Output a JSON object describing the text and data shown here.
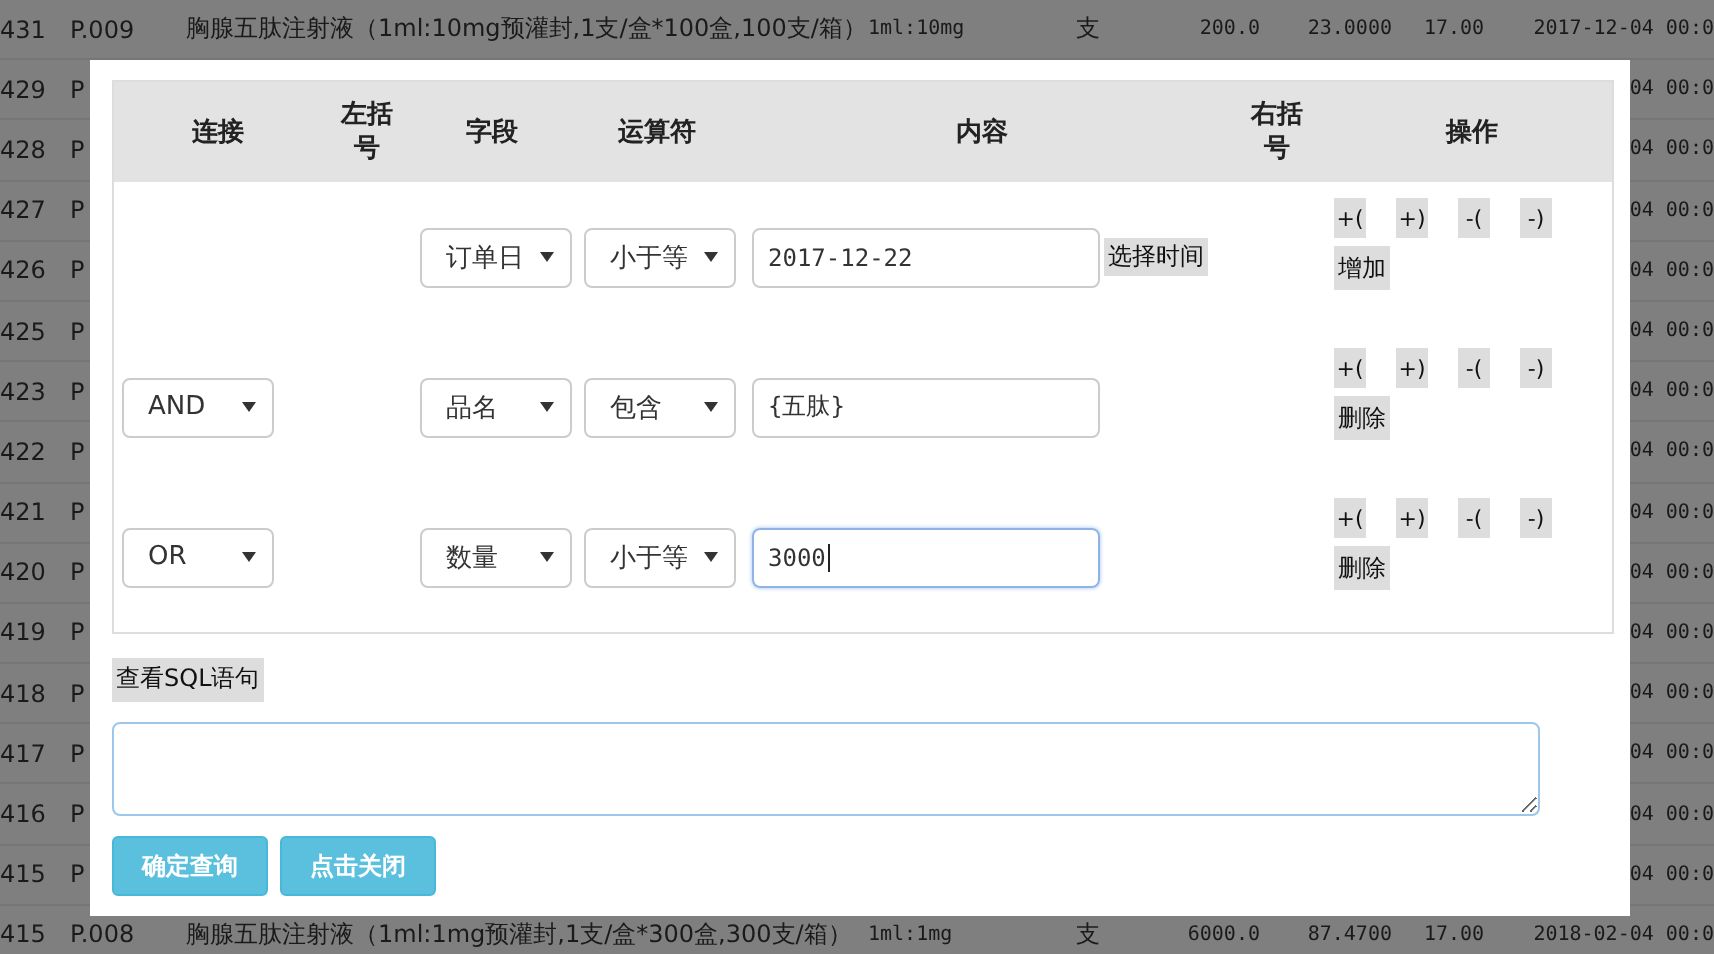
{
  "background_table": {
    "rows": [
      {
        "id": "431",
        "code": "P.009",
        "name": "胸腺五肽注射液（1ml:10mg预灌封,1支/盒*100盒,100支/箱）",
        "spec": "1ml:10mg",
        "unit": "支",
        "quantity": "200.0",
        "price": "23.0000",
        "rate": "17.00",
        "date": "2017-12-04 00:0"
      },
      {
        "id": "429",
        "code": "P",
        "date": "04 00:0"
      },
      {
        "id": "428",
        "code": "P",
        "date": "04 00:0"
      },
      {
        "id": "427",
        "code": "P",
        "date": "04 00:0"
      },
      {
        "id": "426",
        "code": "P",
        "date": "04 00:0"
      },
      {
        "id": "425",
        "code": "P",
        "date": "04 00:0"
      },
      {
        "id": "423",
        "code": "P",
        "date": "04 00:0"
      },
      {
        "id": "422",
        "code": "P",
        "date": "04 00:0"
      },
      {
        "id": "421",
        "code": "P",
        "date": "04 00:0"
      },
      {
        "id": "420",
        "code": "P",
        "date": "04 00:0"
      },
      {
        "id": "419",
        "code": "P",
        "date": "04 00:0"
      },
      {
        "id": "418",
        "code": "P",
        "date": "04 00:0"
      },
      {
        "id": "417",
        "code": "P",
        "date": "04 00:0"
      },
      {
        "id": "416",
        "code": "P",
        "date": "04 00:0"
      },
      {
        "id": "415",
        "code": "P",
        "date": "04 00:0"
      },
      {
        "id": "415",
        "code": "P.008",
        "name": "胸腺五肽注射液（1ml:1mg预灌封,1支/盒*300盒,300支/箱）",
        "spec": "1ml:1mg",
        "unit": "支",
        "quantity": "6000.0",
        "price": "87.4700",
        "rate": "17.00",
        "date": "2018-02-04 00:0"
      }
    ]
  },
  "dialog": {
    "columns": [
      "连接",
      "左括号",
      "字段",
      "运算符",
      "内容",
      "右括号",
      "操作"
    ],
    "conditions": [
      {
        "field": "订单日",
        "operator": "小于等",
        "value": "2017-12-22",
        "picker_button": "选择时间",
        "focused": false,
        "paren_buttons": [
          "+(",
          "+)",
          "-(",
          "-)"
        ],
        "action": "增加"
      },
      {
        "connector": "AND",
        "field": "品名",
        "operator": "包含",
        "value": "{五肽}",
        "focused": false,
        "paren_buttons": [
          "+(",
          "+)",
          "-(",
          "-)"
        ],
        "action": "删除"
      },
      {
        "connector": "OR",
        "field": "数量",
        "operator": "小于等",
        "value": "3000",
        "focused": true,
        "paren_buttons": [
          "+(",
          "+)",
          "-(",
          "-)"
        ],
        "action": "删除"
      }
    ],
    "sql_button": "查看SQL语句",
    "buttons": [
      "确定查询",
      "点击关闭"
    ]
  }
}
